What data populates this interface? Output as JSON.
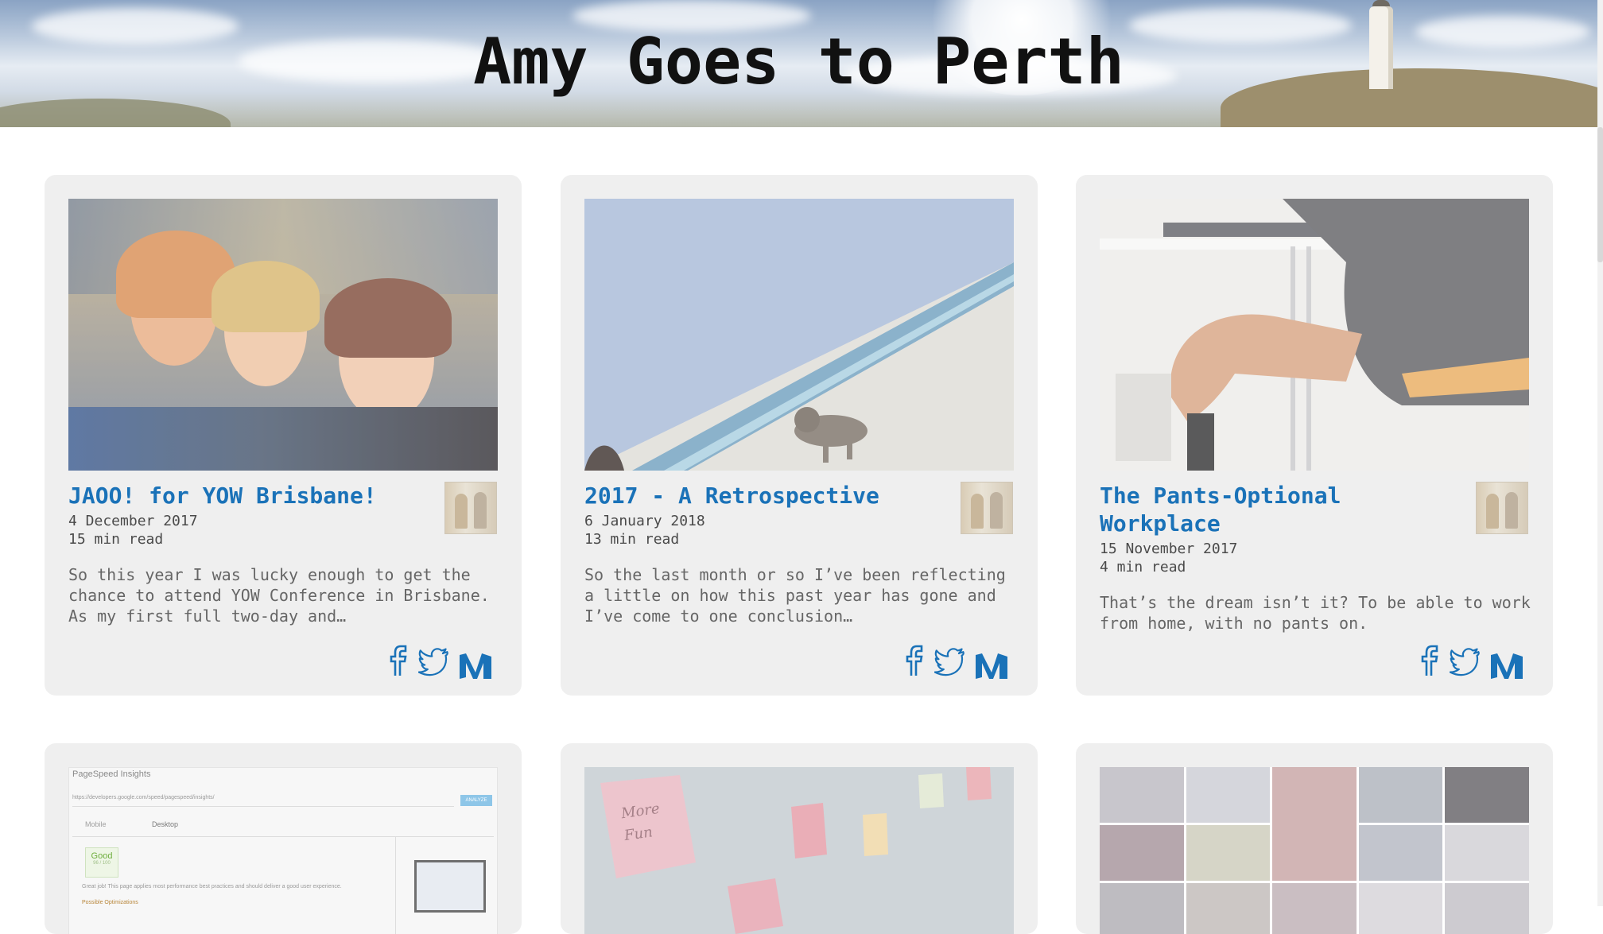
{
  "site": {
    "title": "Amy Goes to Perth"
  },
  "posts": [
    {
      "title": "JAOO! for YOW Brisbane!",
      "date": "4 December 2017",
      "read_time": "15 min read",
      "excerpt": "So this year I was lucky enough to get the chance to attend YOW Conference in Brisbane. As my first full two-day and…"
    },
    {
      "title": "2017 - A Retrospective",
      "date": "6 January 2018",
      "read_time": "13 min read",
      "excerpt": "So the last month or so I’ve been reflecting a little on how this past year has gone and I’ve come to one conclusion…"
    },
    {
      "title": "The Pants-Optional Workplace",
      "date": "15 November 2017",
      "read_time": "4 min read",
      "excerpt": "That’s the dream isn’t it? To be able to work from home, with no pants on."
    },
    {
      "thumbnail_text": {
        "heading": "PageSpeed Insights",
        "url": "https://developers.google.com/speed/pagespeed/insights/",
        "analyze_button": "ANALYZE",
        "tab_mobile": "Mobile",
        "tab_desktop": "Desktop",
        "score_label": "Good",
        "score_sub": "96 / 100",
        "summary": "Great job! This page applies most performance best practices and should deliver a good user experience.",
        "section": "Possible Optimizations"
      }
    },
    {
      "thumbnail_text": {
        "note": "More Fun"
      }
    },
    {}
  ],
  "share_icons": [
    "facebook-icon",
    "twitter-icon",
    "medium-icon"
  ],
  "colors": {
    "accent": "#1a72b8",
    "card_bg": "#efefef",
    "text_muted": "#666666"
  }
}
